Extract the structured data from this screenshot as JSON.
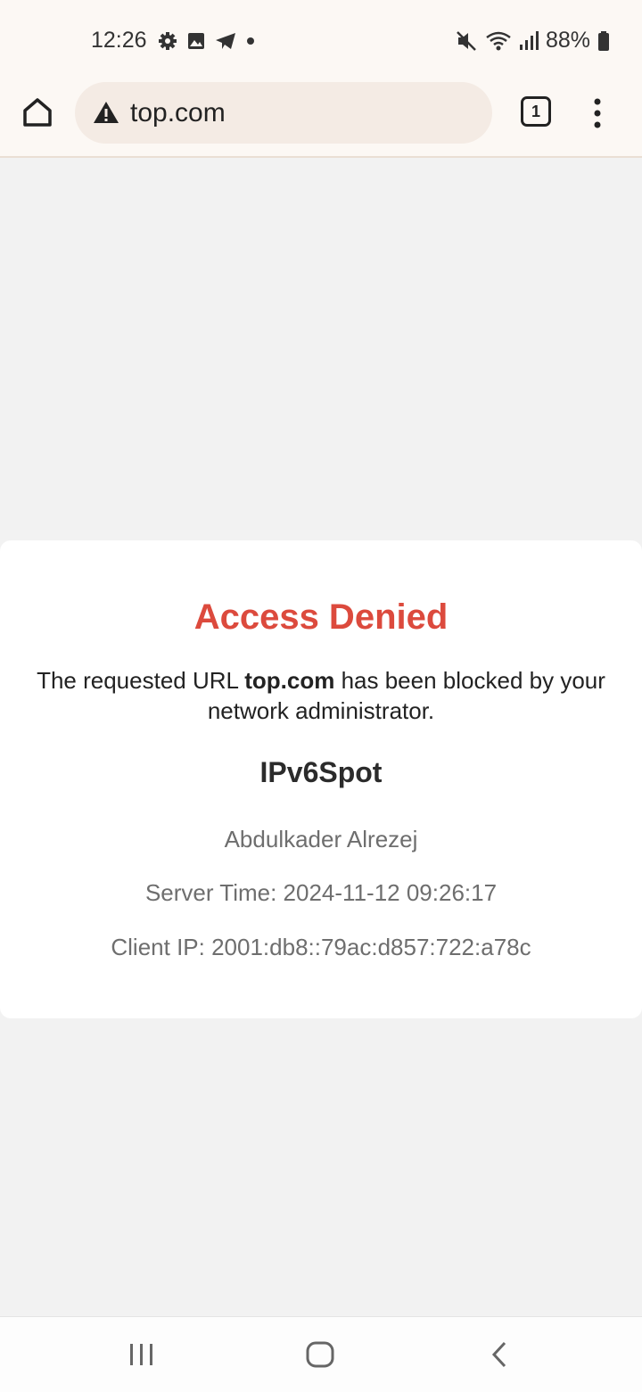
{
  "status_bar": {
    "time": "12:26",
    "left_icons": [
      "gear-icon",
      "image-icon",
      "telegram-icon",
      "dot-icon"
    ],
    "right_icons": [
      "mute-icon",
      "wifi-icon",
      "signal-icon",
      "battery-icon"
    ],
    "battery": "88%"
  },
  "toolbar": {
    "url": "top.com",
    "tab_count": "1"
  },
  "card": {
    "title": "Access Denied",
    "message_prefix": "The requested URL ",
    "message_url": "top.com",
    "message_suffix": " has been blocked by your network administrator.",
    "org": "IPv6Spot",
    "name": "Abdulkader Alrezej",
    "server_time": "Server Time: 2024-11-12 09:26:17",
    "client_ip": "Client IP: 2001:db8::79ac:d857:722:a78c"
  },
  "colors": {
    "title": "#dc4a3d",
    "page_bg": "#f2f2f2",
    "chrome_bg": "#fcf8f4",
    "url_pill": "#f4ebe4"
  }
}
